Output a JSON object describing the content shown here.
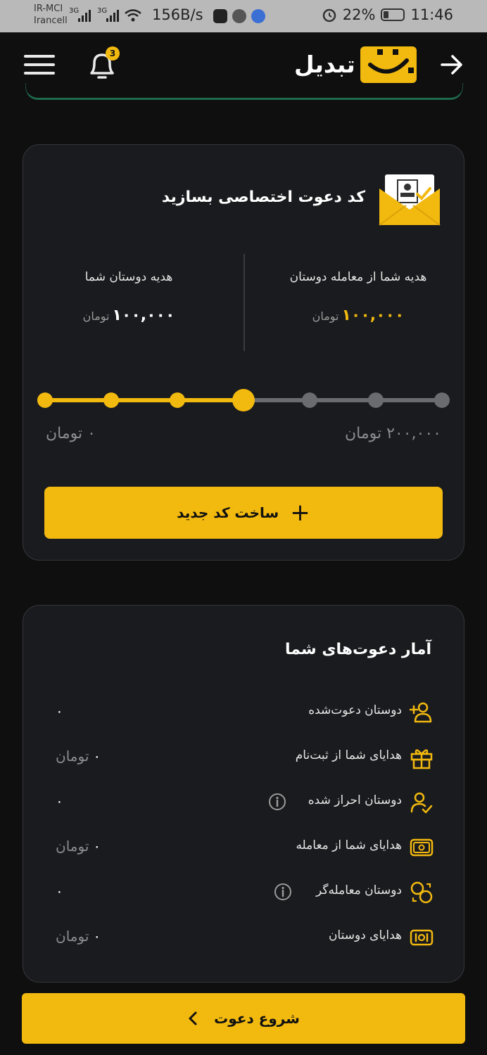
{
  "status_bar": {
    "carrier_1": "IR-MCI",
    "carrier_2": "Irancell",
    "net_1": "3G",
    "net_2": "3G",
    "speed": "156B/s",
    "battery": "22%",
    "time": "11:46"
  },
  "header": {
    "brand": "تبدیل",
    "notification_count": "3",
    "accent_color": "#f2b90f"
  },
  "invite_card": {
    "title": "کد دعوت اختصاصی بسازید",
    "your_gift_label": "هدیه شما از معامله دوستان",
    "your_gift_amount": "۱۰۰,۰۰۰",
    "friends_gift_label": "هدیه دوستان شما",
    "friends_gift_amount": "۱۰۰,۰۰۰",
    "currency": "تومان",
    "slider_min_label": "۰ تومان",
    "slider_max_label": "۲۰۰,۰۰۰ تومان",
    "slider_value_fraction": 0.5,
    "create_button": "ساخت کد جدید"
  },
  "stats_card": {
    "title": "آمار دعوت‌های شما",
    "rows": [
      {
        "label": "دوستان دعوت‌شده",
        "value": "۰",
        "unit": "",
        "icon": "user-plus-icon",
        "info": false
      },
      {
        "label": "هدایای شما از ثبت‌نام",
        "value": "۰",
        "unit": "تومان",
        "icon": "gift-icon",
        "info": false
      },
      {
        "label": "دوستان احراز شده",
        "value": "۰",
        "unit": "",
        "icon": "user-check-icon",
        "info": true
      },
      {
        "label": "هدایای شما از معامله",
        "value": "۰",
        "unit": "تومان",
        "icon": "money-icon",
        "info": false
      },
      {
        "label": "دوستان معامله‌گر",
        "value": "۰",
        "unit": "",
        "icon": "coins-icon",
        "info": true
      },
      {
        "label": "هدایای دوستان",
        "value": "۰",
        "unit": "تومان",
        "icon": "cash-icon",
        "info": false
      }
    ]
  },
  "cta": {
    "label": "شروع دعوت"
  }
}
